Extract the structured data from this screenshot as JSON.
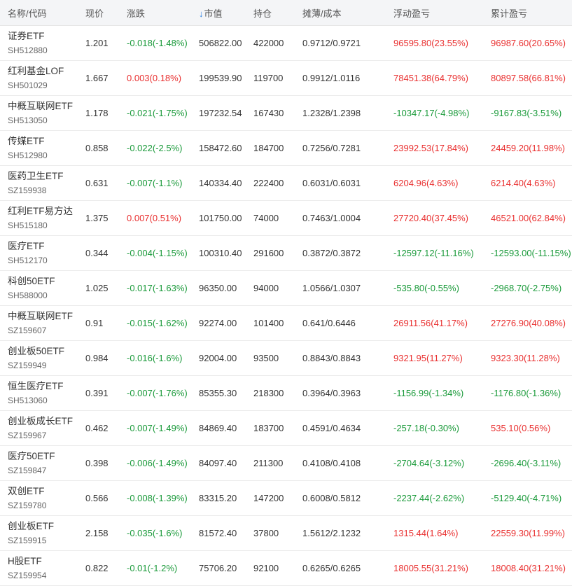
{
  "colors": {
    "up": "#e93030",
    "down": "#1a9a3a",
    "sort_accent": "#2a7fe0",
    "header_bg": "#f4f5f7"
  },
  "header": {
    "name": "名称/代码",
    "price": "现价",
    "change": "涨跌",
    "sort_icon": "arrow-down-icon",
    "sort_arrow": "↓",
    "market_value": "市值",
    "holding": "持仓",
    "cost": "摊薄/成本",
    "float_pnl": "浮动盈亏",
    "total_pnl": "累计盈亏"
  },
  "rows": [
    {
      "name": "证券ETF",
      "code": "SH512880",
      "price": "1.201",
      "change": "-0.018(-1.48%)",
      "change_dir": "down",
      "market_value": "506822.00",
      "holding": "422000",
      "cost": "0.9712/0.9721",
      "float_pnl": "96595.80(23.55%)",
      "float_dir": "up",
      "total_pnl": "96987.60(20.65%)",
      "total_dir": "up"
    },
    {
      "name": "红利基金LOF",
      "code": "SH501029",
      "price": "1.667",
      "change": "0.003(0.18%)",
      "change_dir": "up",
      "market_value": "199539.90",
      "holding": "119700",
      "cost": "0.9912/1.0116",
      "float_pnl": "78451.38(64.79%)",
      "float_dir": "up",
      "total_pnl": "80897.58(66.81%)",
      "total_dir": "up"
    },
    {
      "name": "中概互联网ETF",
      "code": "SH513050",
      "price": "1.178",
      "change": "-0.021(-1.75%)",
      "change_dir": "down",
      "market_value": "197232.54",
      "holding": "167430",
      "cost": "1.2328/1.2398",
      "float_pnl": "-10347.17(-4.98%)",
      "float_dir": "down",
      "total_pnl": "-9167.83(-3.51%)",
      "total_dir": "down"
    },
    {
      "name": "传媒ETF",
      "code": "SH512980",
      "price": "0.858",
      "change": "-0.022(-2.5%)",
      "change_dir": "down",
      "market_value": "158472.60",
      "holding": "184700",
      "cost": "0.7256/0.7281",
      "float_pnl": "23992.53(17.84%)",
      "float_dir": "up",
      "total_pnl": "24459.20(11.98%)",
      "total_dir": "up"
    },
    {
      "name": "医药卫生ETF",
      "code": "SZ159938",
      "price": "0.631",
      "change": "-0.007(-1.1%)",
      "change_dir": "down",
      "market_value": "140334.40",
      "holding": "222400",
      "cost": "0.6031/0.6031",
      "float_pnl": "6204.96(4.63%)",
      "float_dir": "up",
      "total_pnl": "6214.40(4.63%)",
      "total_dir": "up"
    },
    {
      "name": "红利ETF易方达",
      "code": "SH515180",
      "price": "1.375",
      "change": "0.007(0.51%)",
      "change_dir": "up",
      "market_value": "101750.00",
      "holding": "74000",
      "cost": "0.7463/1.0004",
      "float_pnl": "27720.40(37.45%)",
      "float_dir": "up",
      "total_pnl": "46521.00(62.84%)",
      "total_dir": "up"
    },
    {
      "name": "医疗ETF",
      "code": "SH512170",
      "price": "0.344",
      "change": "-0.004(-1.15%)",
      "change_dir": "down",
      "market_value": "100310.40",
      "holding": "291600",
      "cost": "0.3872/0.3872",
      "float_pnl": "-12597.12(-11.16%)",
      "float_dir": "down",
      "total_pnl": "-12593.00(-11.15%)",
      "total_dir": "down"
    },
    {
      "name": "科创50ETF",
      "code": "SH588000",
      "price": "1.025",
      "change": "-0.017(-1.63%)",
      "change_dir": "down",
      "market_value": "96350.00",
      "holding": "94000",
      "cost": "1.0566/1.0307",
      "float_pnl": "-535.80(-0.55%)",
      "float_dir": "down",
      "total_pnl": "-2968.70(-2.75%)",
      "total_dir": "down"
    },
    {
      "name": "中概互联网ETF",
      "code": "SZ159607",
      "price": "0.91",
      "change": "-0.015(-1.62%)",
      "change_dir": "down",
      "market_value": "92274.00",
      "holding": "101400",
      "cost": "0.641/0.6446",
      "float_pnl": "26911.56(41.17%)",
      "float_dir": "up",
      "total_pnl": "27276.90(40.08%)",
      "total_dir": "up"
    },
    {
      "name": "创业板50ETF",
      "code": "SZ159949",
      "price": "0.984",
      "change": "-0.016(-1.6%)",
      "change_dir": "down",
      "market_value": "92004.00",
      "holding": "93500",
      "cost": "0.8843/0.8843",
      "float_pnl": "9321.95(11.27%)",
      "float_dir": "up",
      "total_pnl": "9323.30(11.28%)",
      "total_dir": "up"
    },
    {
      "name": "恒生医疗ETF",
      "code": "SH513060",
      "price": "0.391",
      "change": "-0.007(-1.76%)",
      "change_dir": "down",
      "market_value": "85355.30",
      "holding": "218300",
      "cost": "0.3964/0.3963",
      "float_pnl": "-1156.99(-1.34%)",
      "float_dir": "down",
      "total_pnl": "-1176.80(-1.36%)",
      "total_dir": "down"
    },
    {
      "name": "创业板成长ETF",
      "code": "SZ159967",
      "price": "0.462",
      "change": "-0.007(-1.49%)",
      "change_dir": "down",
      "market_value": "84869.40",
      "holding": "183700",
      "cost": "0.4591/0.4634",
      "float_pnl": "-257.18(-0.30%)",
      "float_dir": "down",
      "total_pnl": "535.10(0.56%)",
      "total_dir": "up"
    },
    {
      "name": "医疗50ETF",
      "code": "SZ159847",
      "price": "0.398",
      "change": "-0.006(-1.49%)",
      "change_dir": "down",
      "market_value": "84097.40",
      "holding": "211300",
      "cost": "0.4108/0.4108",
      "float_pnl": "-2704.64(-3.12%)",
      "float_dir": "down",
      "total_pnl": "-2696.40(-3.11%)",
      "total_dir": "down"
    },
    {
      "name": "双创ETF",
      "code": "SZ159780",
      "price": "0.566",
      "change": "-0.008(-1.39%)",
      "change_dir": "down",
      "market_value": "83315.20",
      "holding": "147200",
      "cost": "0.6008/0.5812",
      "float_pnl": "-2237.44(-2.62%)",
      "float_dir": "down",
      "total_pnl": "-5129.40(-4.71%)",
      "total_dir": "down"
    },
    {
      "name": "创业板ETF",
      "code": "SZ159915",
      "price": "2.158",
      "change": "-0.035(-1.6%)",
      "change_dir": "down",
      "market_value": "81572.40",
      "holding": "37800",
      "cost": "1.5612/2.1232",
      "float_pnl": "1315.44(1.64%)",
      "float_dir": "up",
      "total_pnl": "22559.30(11.99%)",
      "total_dir": "up"
    },
    {
      "name": "H股ETF",
      "code": "SZ159954",
      "price": "0.822",
      "change": "-0.01(-1.2%)",
      "change_dir": "down",
      "market_value": "75706.20",
      "holding": "92100",
      "cost": "0.6265/0.6265",
      "float_pnl": "18005.55(31.21%)",
      "float_dir": "up",
      "total_pnl": "18008.40(31.21%)",
      "total_dir": "up"
    }
  ]
}
